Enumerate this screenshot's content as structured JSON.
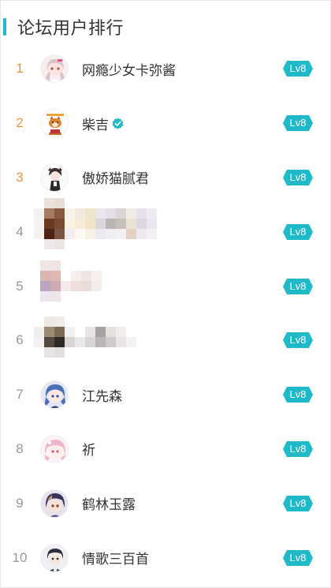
{
  "header": {
    "title": "论坛用户排行"
  },
  "colors": {
    "accent": "#1fbac9",
    "top_rank": "#f0923a",
    "rank": "#999999",
    "badge": "#1fbac9"
  },
  "ranking": [
    {
      "rank": "1",
      "name": "网瘾少女卡弥酱",
      "level": "Lv8",
      "avatar": "anime-girl-pink"
    },
    {
      "rank": "2",
      "name": "柴吉",
      "level": "Lv8",
      "avatar": "shiba-dog",
      "verified": true
    },
    {
      "rank": "3",
      "name": "傲娇猫腻君",
      "level": "Lv8",
      "avatar": "anime-cat-boy"
    },
    {
      "rank": "4",
      "name": "",
      "level": "Lv8",
      "avatar": "blurred"
    },
    {
      "rank": "5",
      "name": "",
      "level": "Lv8",
      "avatar": "blurred"
    },
    {
      "rank": "6",
      "name": "",
      "level": "Lv8",
      "avatar": "blurred"
    },
    {
      "rank": "7",
      "name": "江先森",
      "level": "Lv8",
      "avatar": "anime-blue-hair"
    },
    {
      "rank": "8",
      "name": "祈",
      "level": "Lv8",
      "avatar": "anime-pink-hair"
    },
    {
      "rank": "9",
      "name": "鹤林玉露",
      "level": "Lv8",
      "avatar": "anime-dark-hair"
    },
    {
      "rank": "10",
      "name": "情歌三百首",
      "level": "Lv8",
      "avatar": "anime-boy"
    }
  ]
}
